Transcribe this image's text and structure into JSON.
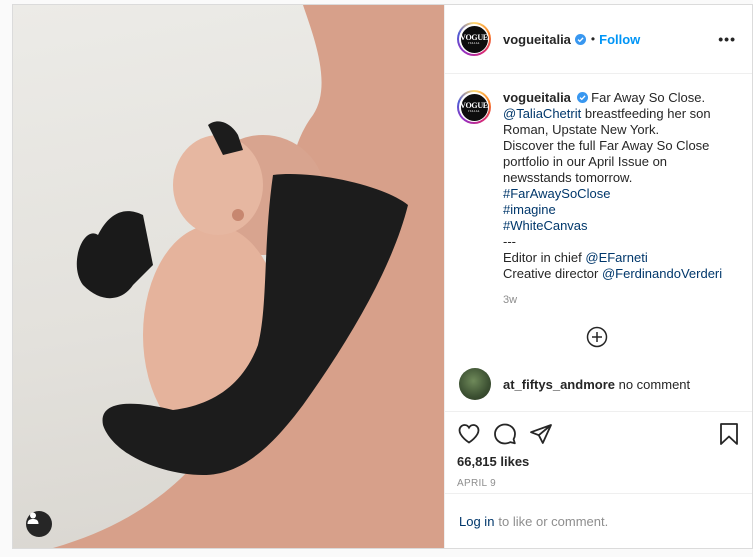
{
  "post": {
    "account": {
      "username": "vogueitalia",
      "avatar_line1": "VOGUE",
      "avatar_line2": "ITALIA",
      "verified": true,
      "dot": "•",
      "follow_label": "Follow",
      "more_label": "•••"
    },
    "caption": {
      "username": "vogueitalia",
      "lines": [
        {
          "text": "Far Away So Close.",
          "type": "inline-first"
        },
        {
          "mention": "@TaliaChetrit",
          "text": " breastfeeding her son"
        },
        {
          "text": "Roman, Upstate New York."
        },
        {
          "text": "Discover the full Far Away So Close"
        },
        {
          "text": "portfolio in our April Issue on"
        },
        {
          "text": "newsstands tomorrow."
        },
        {
          "hashtag": "#FarAwaySoClose"
        },
        {
          "hashtag": "#imagine"
        },
        {
          "hashtag": "#WhiteCanvas"
        },
        {
          "text": "---"
        },
        {
          "text": "Editor in chief ",
          "mention": "@EFarneti"
        },
        {
          "text": "Creative director ",
          "mention": "@FerdinandoVerderi"
        }
      ],
      "time_ago": "3w"
    },
    "load_more_icon": "plus-circle-icon",
    "comments": [
      {
        "username": "at_fiftys_andmore",
        "text": "no comment"
      }
    ],
    "likes": "66,815 likes",
    "date": "APRIL 9",
    "login_prompt": {
      "link": "Log in",
      "text": "to like or comment."
    },
    "icons": [
      "heart-icon",
      "comment-icon",
      "share-icon",
      "save-icon",
      "user-tag-icon",
      "verified-badge-icon"
    ],
    "colors": {
      "accent": "#0095f6",
      "link": "#00376b",
      "muted": "#8e8e8e",
      "text": "#262626",
      "border": "#dbdbdb"
    }
  }
}
